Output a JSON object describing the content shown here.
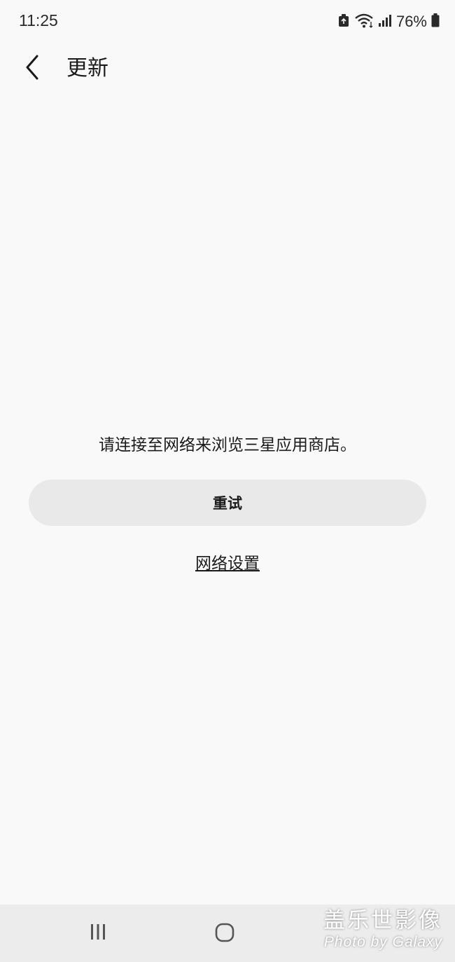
{
  "status_bar": {
    "time": "11:25",
    "battery": "76%",
    "icons": [
      "recycle-icon",
      "wifi-icon",
      "signal-icon",
      "battery-icon"
    ]
  },
  "app_bar": {
    "back_icon": "chevron-left-icon",
    "title": "更新"
  },
  "content": {
    "message": "请连接至网络来浏览三星应用商店。",
    "retry_label": "重试",
    "network_settings_label": "网络设置"
  },
  "nav_bar": {
    "icons": [
      "recents-icon",
      "home-icon"
    ]
  },
  "watermark": {
    "title": "盖乐世影像",
    "subtitle": "Photo by Galaxy"
  },
  "colors": {
    "background": "#f9f9f9",
    "button_bg": "#e9e9e9",
    "text": "#1a1a1a",
    "nav_bg": "#ececec"
  }
}
